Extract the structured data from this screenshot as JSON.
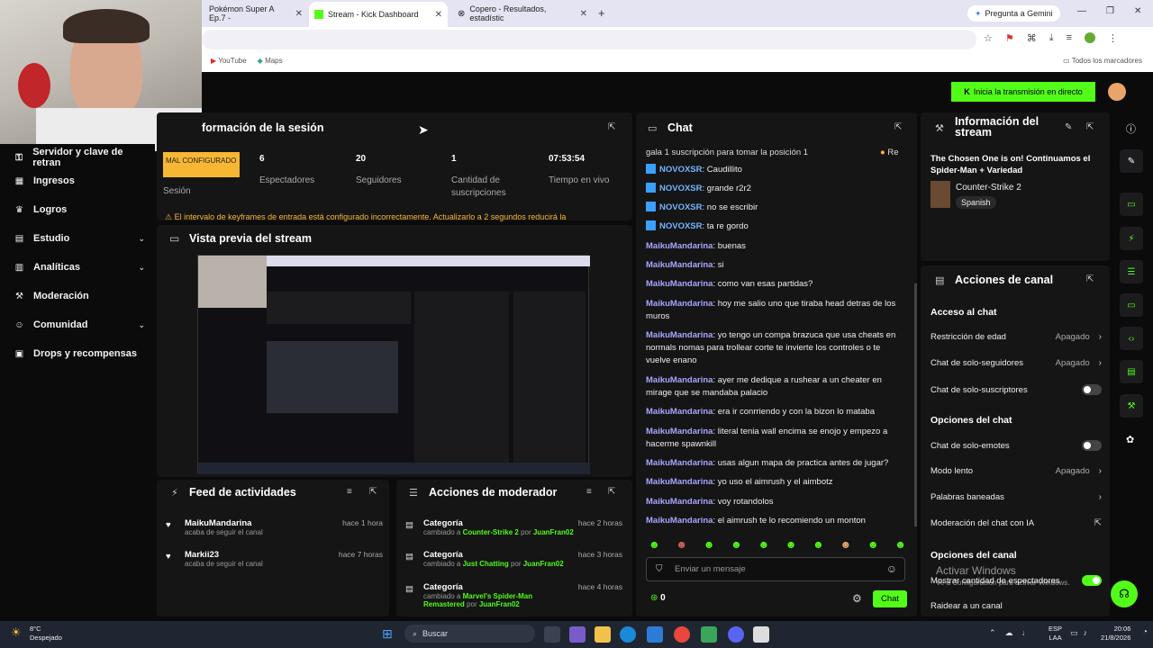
{
  "browser": {
    "tabs": [
      {
        "title": "Pokémon Super A Ep.7 -",
        "active": false
      },
      {
        "title": "Stream - Kick Dashboard",
        "active": true
      },
      {
        "title": "Copero - Resultados, estadístic",
        "active": false
      }
    ],
    "gemini_label": "Pregunta a Gemini",
    "bookmarks": [
      "YouTube",
      "Maps"
    ],
    "all_bookmarks": "Todos los marcadores"
  },
  "header": {
    "go_live": "Inicia la transmisión en directo"
  },
  "sidebar": {
    "items": [
      {
        "label": "Servidor y clave de retran",
        "icon": "key-icon"
      },
      {
        "label": "Ingresos",
        "icon": "chart-icon"
      },
      {
        "label": "Logros",
        "icon": "trophy-icon"
      },
      {
        "label": "Estudio",
        "icon": "grid-icon"
      },
      {
        "label": "Analíticas",
        "icon": "analytics-icon"
      },
      {
        "label": "Moderación",
        "icon": "wrench-icon"
      },
      {
        "label": "Comunidad",
        "icon": "people-icon"
      },
      {
        "label": "Drops y recompensas",
        "icon": "gift-icon"
      }
    ]
  },
  "session": {
    "title": "formación de la sesión",
    "badge": "MAL CONFIGURADO",
    "badge_label": "Sesión",
    "stats": [
      {
        "value": "6",
        "label": "Espectadores"
      },
      {
        "value": "20",
        "label": "Seguidores"
      },
      {
        "value": "1",
        "label": "Cantidad de suscripciones"
      },
      {
        "value": "07:53:54",
        "label": "Tiempo en vivo"
      }
    ],
    "warning": "El intervalo de keyframes de entrada está configurado incorrectamente. Actualizarlo a 2 segundos reducirá la"
  },
  "preview": {
    "title": "Vista previa del stream"
  },
  "activity": {
    "title": "Feed de actividades",
    "items": [
      {
        "user": "MaikuMandarina",
        "action": "acaba de seguir el canal",
        "time": "hace 1 hora"
      },
      {
        "user": "Markii23",
        "action": "acaba de seguir el canal",
        "time": "hace 7 horas"
      }
    ]
  },
  "modactions": {
    "title": "Acciones de moderador",
    "items": [
      {
        "label": "Categoría",
        "prefix": "cambiado a",
        "target": "Counter-Strike 2",
        "by": "por",
        "mod": "JuanFran02",
        "time": "hace 2 horas"
      },
      {
        "label": "Categoría",
        "prefix": "cambiado a",
        "target": "Just Chatting",
        "by": "por",
        "mod": "JuanFran02",
        "time": "hace 3 horas"
      },
      {
        "label": "Categoría",
        "prefix": "cambiado a",
        "target": "Marvel's Spider-Man Remastered",
        "by": "por",
        "mod": "JuanFran02",
        "time": "hace 4 horas"
      }
    ]
  },
  "chat": {
    "title": "Chat",
    "pinned": "gala 1 suscripción para tomar la posición 1",
    "pinned_right": "Re",
    "messages": [
      {
        "user": "NOVOXSR",
        "text": "Caudillito",
        "badge": true
      },
      {
        "user": "NOVOXSR",
        "text": "grande r2r2",
        "badge": true
      },
      {
        "user": "NOVOXSR",
        "text": "no se escribir",
        "badge": true
      },
      {
        "user": "NOVOXSR",
        "text": "ta re gordo",
        "badge": true
      },
      {
        "user": "MaikuMandarina",
        "text": "buenas"
      },
      {
        "user": "MaikuMandarina",
        "text": "si"
      },
      {
        "user": "MaikuMandarina",
        "text": "como van esas partidas?"
      },
      {
        "user": "MaikuMandarina",
        "text": "hoy me salio uno que tiraba head detras de los muros"
      },
      {
        "user": "MaikuMandarina",
        "text": "yo tengo un compa brazuca que usa cheats en normals nomas para trollear corte te invierte los controles o te vuelve enano"
      },
      {
        "user": "MaikuMandarina",
        "text": "ayer me dedique a rushear a un cheater en mirage que se mandaba palacio"
      },
      {
        "user": "MaikuMandarina",
        "text": "era ir conrriendo y con la bizon lo mataba"
      },
      {
        "user": "MaikuMandarina",
        "text": "literal tenia wall encima se enojo y empezo a hacerme spawnkill"
      },
      {
        "user": "MaikuMandarina",
        "text": "usas algun mapa de practica antes de jugar?"
      },
      {
        "user": "MaikuMandarina",
        "text": "yo uso el aimrush y el aimbotz"
      },
      {
        "user": "MaikuMandarina",
        "text": "voy rotandolos"
      },
      {
        "user": "MaikuMandarina",
        "text": "el aimrush te lo recomiendo un monton"
      }
    ],
    "placeholder": "Enviar un mensaje",
    "points": "0",
    "send": "Chat"
  },
  "streaminfo": {
    "title": "Información del stream",
    "stream_title": "The Chosen One is on! Continuamos el Spider-Man + Variedad",
    "game": "Counter-Strike 2",
    "language": "Spanish"
  },
  "channel": {
    "title": "Acciones de canal",
    "chat_access": "Acceso al chat",
    "rows1": [
      {
        "label": "Restricción de edad",
        "state": "Apagado",
        "type": "chevron"
      },
      {
        "label": "Chat de solo-seguidores",
        "state": "Apagado",
        "type": "chevron"
      },
      {
        "label": "Chat de solo-suscriptores",
        "state": "",
        "type": "toggle",
        "on": false
      }
    ],
    "chat_options": "Opciones del chat",
    "rows2": [
      {
        "label": "Chat de solo-emotes",
        "state": "",
        "type": "toggle",
        "on": false
      },
      {
        "label": "Modo lento",
        "state": "Apagado",
        "type": "chevron"
      },
      {
        "label": "Palabras baneadas",
        "state": "",
        "type": "chevron"
      },
      {
        "label": "Moderación del chat con IA",
        "state": "",
        "type": "external"
      }
    ],
    "channel_options": "Opciones del canal",
    "rows3": [
      {
        "label": "Mostrar cantidad de espectadores",
        "state": "",
        "type": "toggle",
        "on": true
      },
      {
        "label": "Raidear a un canal",
        "state": "",
        "type": "none"
      }
    ]
  },
  "watermark": {
    "line1": "Activar Windows",
    "line2": "Ve a Configuración para activar Windows."
  },
  "taskbar": {
    "weather_temp": "8°C",
    "weather_desc": "Despejado",
    "search": "Buscar",
    "lang1": "ESP",
    "lang2": "LAA",
    "time": "20:06",
    "date": "21/8/2026"
  }
}
